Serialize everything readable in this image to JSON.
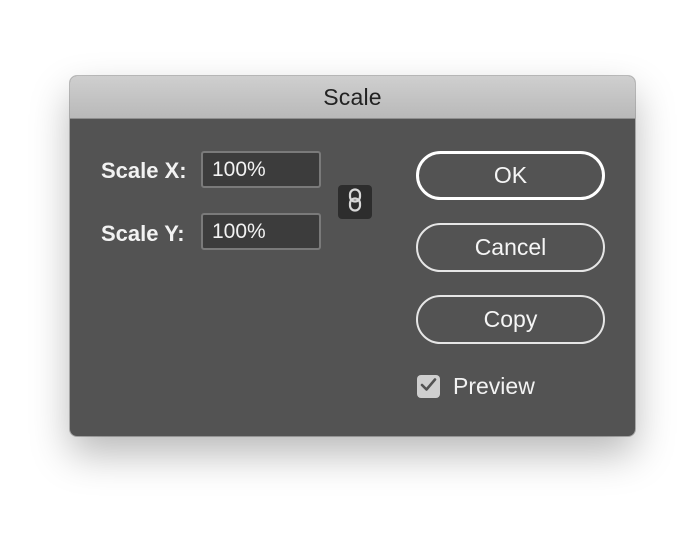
{
  "dialog": {
    "title": "Scale",
    "scale_x": {
      "label": "Scale X:",
      "value": "100%"
    },
    "scale_y": {
      "label": "Scale Y:",
      "value": "100%"
    },
    "constrain_icon": "link-icon",
    "buttons": {
      "ok": "OK",
      "cancel": "Cancel",
      "copy": "Copy"
    },
    "preview": {
      "label": "Preview",
      "checked": true
    }
  },
  "colors": {
    "dialog_bg": "#535353",
    "titlebar_bg": "#c4c4c4",
    "field_bg": "#3c3c3c",
    "text": "#f2f2f2"
  }
}
